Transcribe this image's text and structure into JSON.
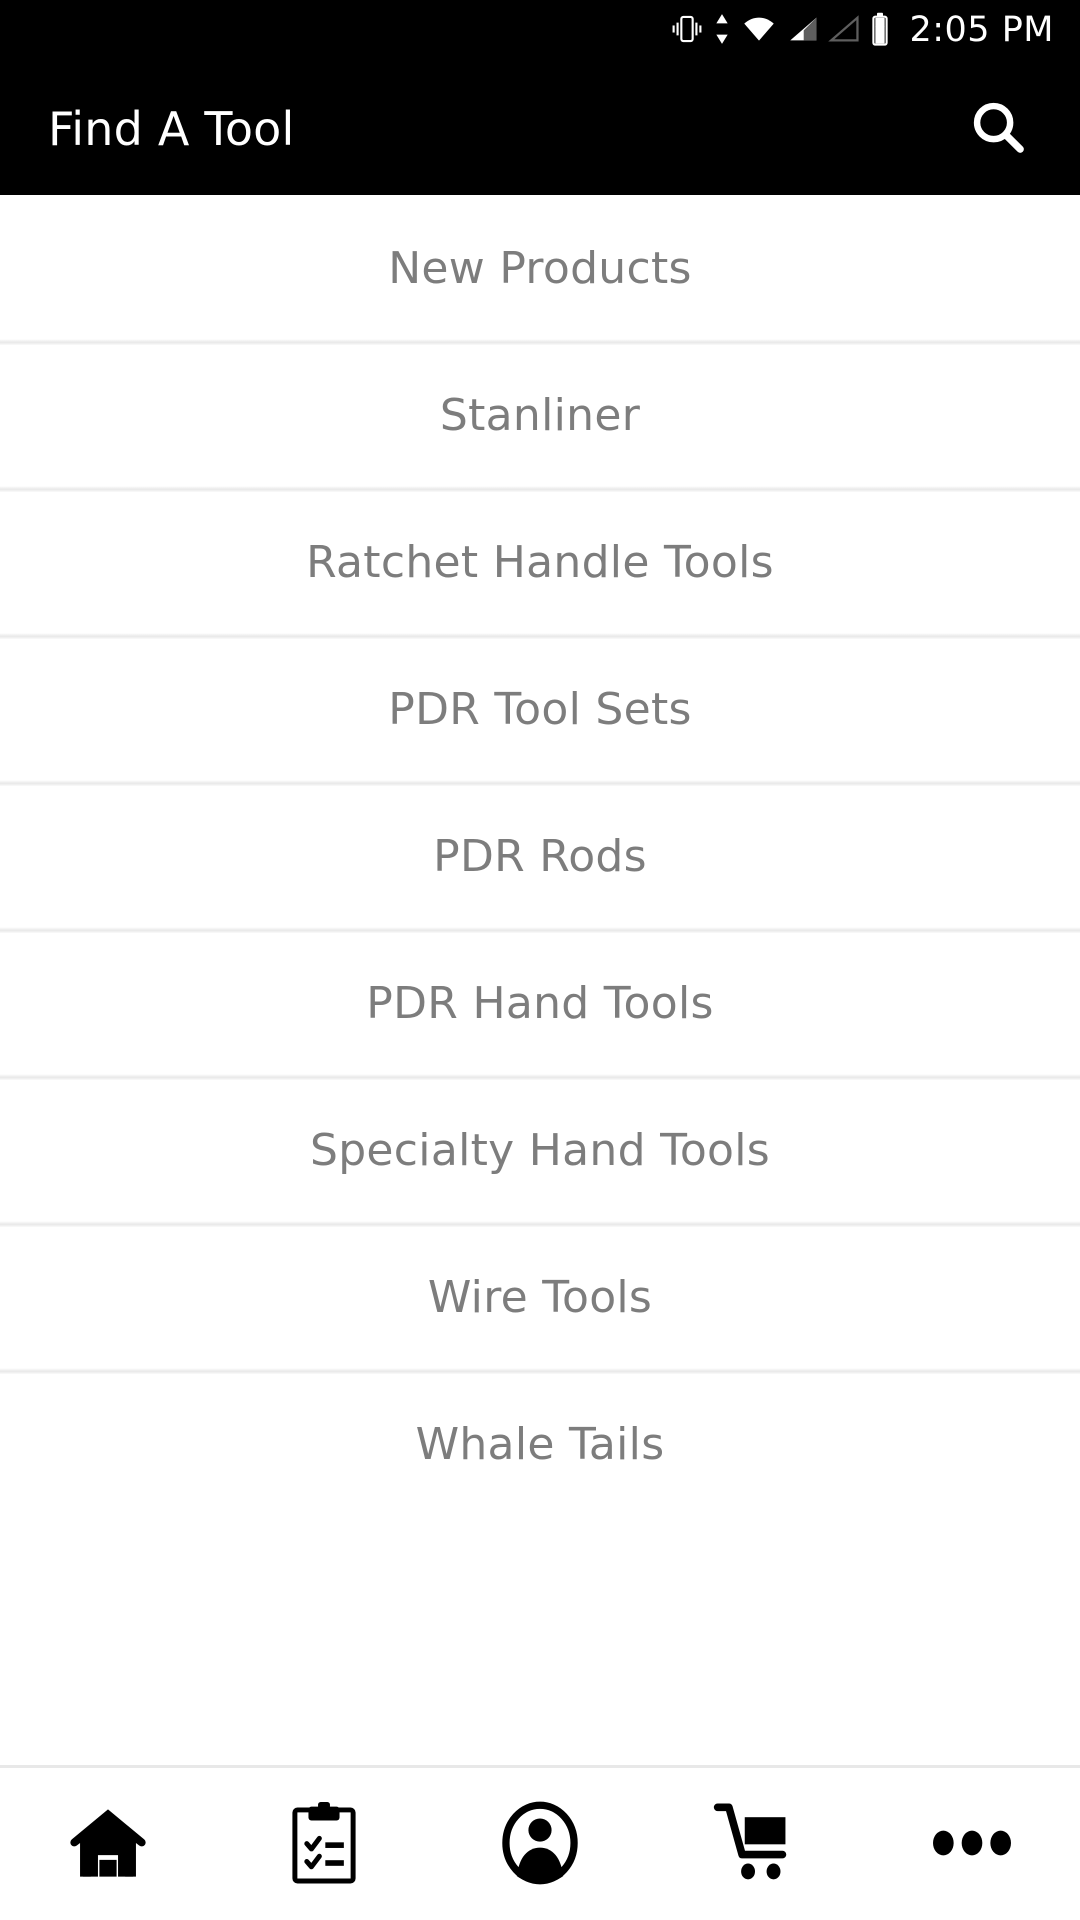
{
  "status_bar": {
    "time": "2:05 PM",
    "icons": [
      {
        "name": "vibrate-icon",
        "label": "vibrate"
      },
      {
        "name": "data-transfer-icon",
        "label": "data transfer"
      },
      {
        "name": "wifi-icon",
        "label": "wifi full"
      },
      {
        "name": "cellular-signal-icon",
        "label": "cellular signal"
      },
      {
        "name": "cellular-signal-empty-icon",
        "label": "cellular signal empty"
      },
      {
        "name": "battery-icon",
        "label": "battery"
      }
    ],
    "background_color": "#000000",
    "foreground_color": "#ffffff"
  },
  "app_bar": {
    "title": "Find A Tool",
    "search_label": "Search",
    "background_color": "#000000",
    "title_color": "#ffffff"
  },
  "list": {
    "text_color": "#7d7d7d",
    "divider_color": "#e9e9e9",
    "items": [
      {
        "label": "New Products"
      },
      {
        "label": "Stanliner"
      },
      {
        "label": "Ratchet Handle Tools"
      },
      {
        "label": "PDR Tool Sets"
      },
      {
        "label": "PDR Rods"
      },
      {
        "label": "PDR Hand Tools"
      },
      {
        "label": "Specialty Hand Tools"
      },
      {
        "label": "Wire Tools"
      },
      {
        "label": "Whale Tails"
      }
    ]
  },
  "bottom_nav": {
    "background_color": "#ffffff",
    "icon_color": "#000000",
    "items": [
      {
        "name": "home-icon",
        "label": "Home"
      },
      {
        "name": "clipboard-checklist-icon",
        "label": "Orders"
      },
      {
        "name": "account-circle-icon",
        "label": "Account"
      },
      {
        "name": "shopping-cart-icon",
        "label": "Cart"
      },
      {
        "name": "more-ellipsis-icon",
        "label": "More"
      }
    ]
  }
}
